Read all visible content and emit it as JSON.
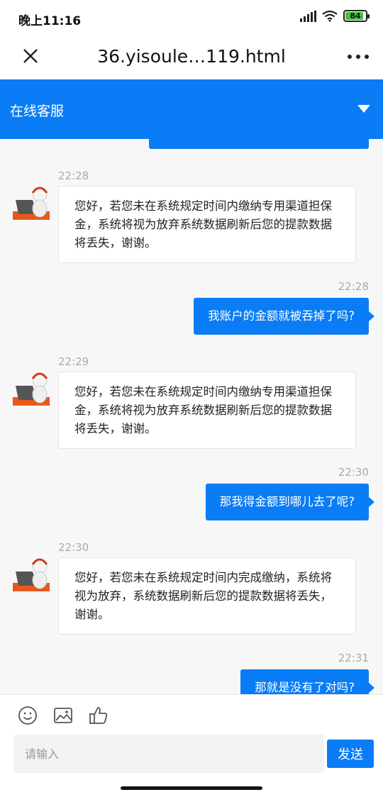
{
  "status_bar": {
    "time": "晚上11:16",
    "battery": "84"
  },
  "browser": {
    "title": "36.yisoule…119.html"
  },
  "chat_header": {
    "title": "在线客服"
  },
  "messages": [
    {
      "time": "22:28",
      "text": "您好，若您未在系统规定时间内缴纳专用渠道担保金，系统将视为放弃系统数据刷新后您的提款数据将丢失，谢谢。"
    },
    {
      "time": "22:28",
      "text": "我账户的金额就被吞掉了吗?"
    },
    {
      "time": "22:29",
      "text": "您好，若您未在系统规定时间内缴纳专用渠道担保金，系统将视为放弃系统数据刷新后您的提款数据将丢失，谢谢。"
    },
    {
      "time": "22:30",
      "text": "那我得金额到哪儿去了呢?"
    },
    {
      "time": "22:30",
      "text": "您好，若您未在系统规定时间内完成缴纳，系统将视为放弃，系统数据刷新后您的提款数据将丢失，谢谢。"
    },
    {
      "time": "22:31",
      "text": "那就是没有了对吗?"
    }
  ],
  "composer": {
    "placeholder": "请输入",
    "send_label": "发送"
  },
  "colors": {
    "accent": "#0a7cf5",
    "chat_bg": "#f7f7f8"
  },
  "icons": [
    "close-icon",
    "more-icon",
    "dropdown-icon",
    "emoji-icon",
    "image-icon",
    "thumbs-up-icon"
  ]
}
